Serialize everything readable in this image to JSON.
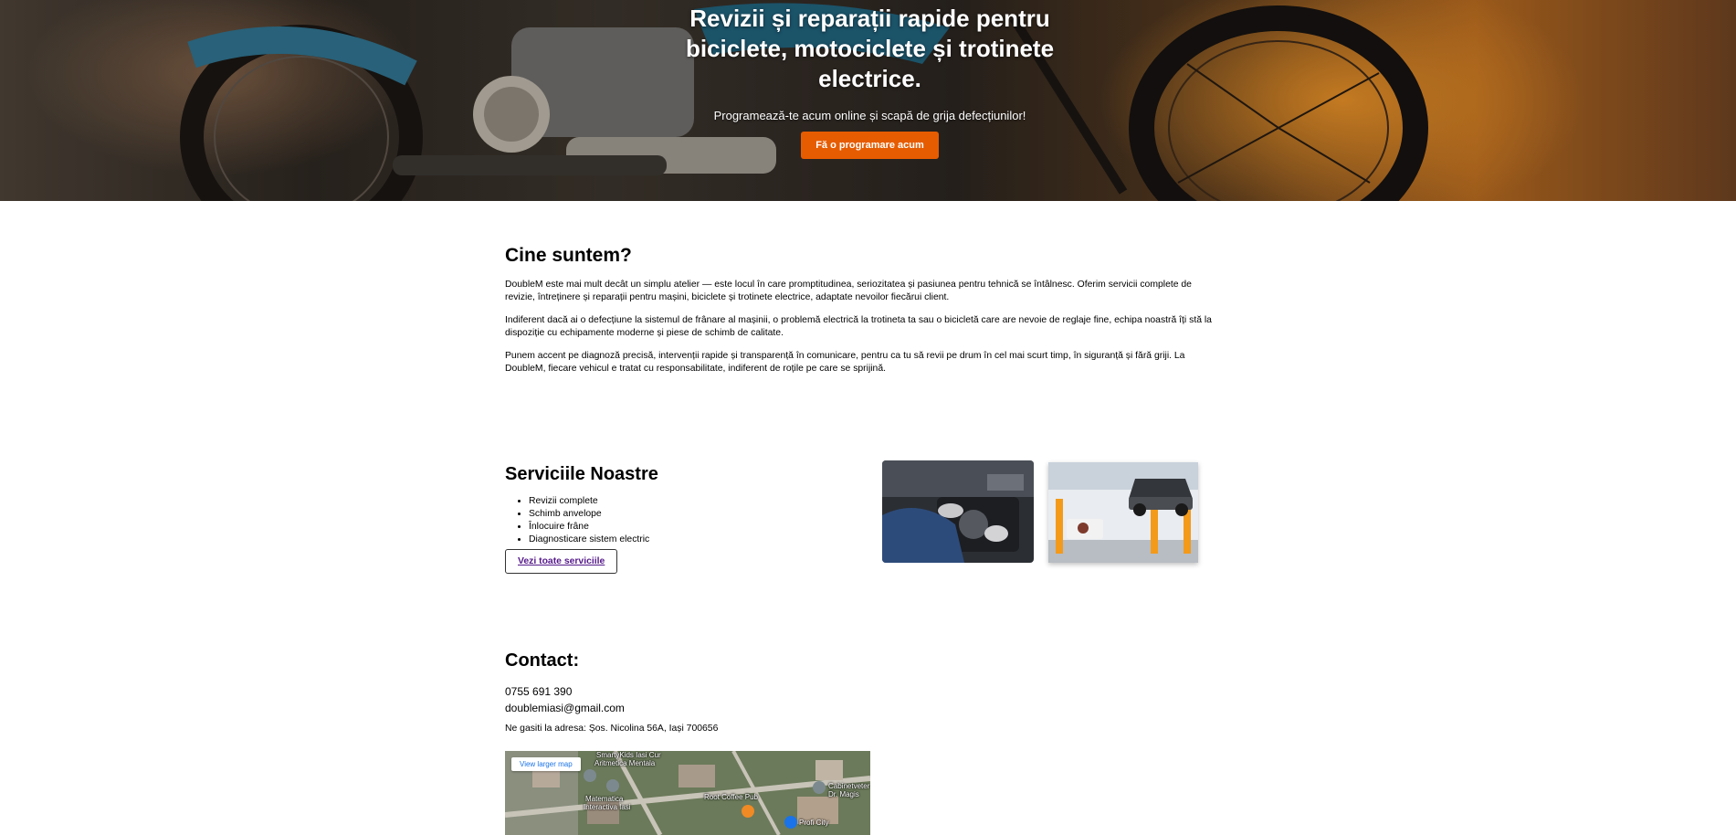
{
  "hero": {
    "title": "Revizii și reparații rapide pentru biciclete, motociclete și trotinete electrice.",
    "subtitle": "Programează-te acum online și scapă de grija defecțiunilor!",
    "cta_label": "Fă o programare acum"
  },
  "about": {
    "heading": "Cine suntem?",
    "paragraphs": [
      "DoubleM este mai mult decât un simplu atelier — este locul în care promptitudinea, seriozitatea și pasiunea pentru tehnică se întâlnesc. Oferim servicii complete de revizie, întreținere și reparații pentru mașini, biciclete și trotinete electrice, adaptate nevoilor fiecărui client.",
      "Indiferent dacă ai o defecțiune la sistemul de frânare al mașinii, o problemă electrică la trotineta ta sau o bicicletă care are nevoie de reglaje fine, echipa noastră îți stă la dispoziție cu echipamente moderne și piese de schimb de calitate.",
      "Punem accent pe diagnoză precisă, intervenții rapide și transparență în comunicare, pentru ca tu să revii pe drum în cel mai scurt timp, în siguranță și fără griji. La DoubleM, fiecare vehicul e tratat cu responsabilitate, indiferent de roțile pe care se sprijină."
    ]
  },
  "services": {
    "heading": "Serviciile Noastre",
    "items": [
      "Revizii complete",
      "Schimb anvelope",
      "Înlocuire frâne",
      "Diagnosticare sistem electric"
    ],
    "all_label": "Vezi toate serviciile"
  },
  "contact": {
    "heading": "Contact:",
    "phone": "0755 691 390",
    "email": "doublemiasi@gmail.com",
    "address": "Ne gasiti la adresa: Șos. Nicolina 56A, Iași 700656"
  },
  "map": {
    "larger_map_label": "View larger map",
    "labels": [
      "SmartyKids Iasi Cur",
      "Aritmetica Mentala",
      "Matematica",
      "Interactiva Iasi",
      "Root Coffee Pub",
      "Profi City",
      "Cabinetveter",
      "Dr. Magis"
    ]
  }
}
